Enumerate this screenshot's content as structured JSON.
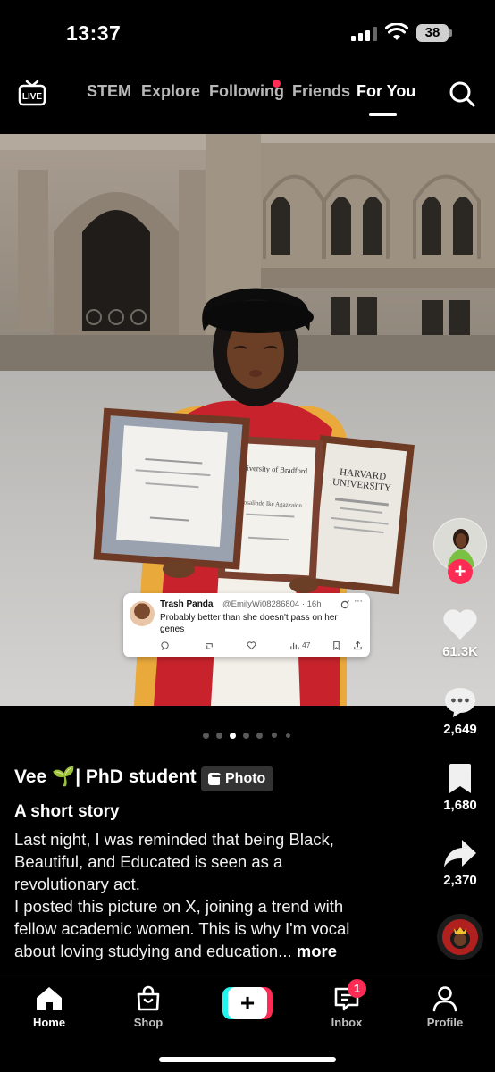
{
  "status_bar": {
    "time": "13:37",
    "battery": "38"
  },
  "top_nav": {
    "live_label": "LIVE",
    "tabs": [
      {
        "label": "STEM"
      },
      {
        "label": "Explore"
      },
      {
        "label": "Following"
      },
      {
        "label": "For You"
      }
    ],
    "active_tab": "For You",
    "following_has_dot": true
  },
  "post": {
    "media_type": "photo carousel",
    "carousel": {
      "total": 7,
      "active_index": 2
    },
    "tweet": {
      "name": "Trash Panda",
      "handle": "@EmilyWi08286804 · 16h",
      "text": "Probably better than she doesn't pass on her genes",
      "views": "47"
    },
    "diploma_texts": {
      "university": "University of Bradford",
      "harvard_1": "HARVARD",
      "harvard_2": "UNIVERSITY",
      "recipient": "Rosalinde Ike Agazzaion"
    },
    "author": "Vee 🌱| PhD student",
    "badge": "Photo",
    "title": "A short story",
    "description_lines": [
      "Last night, I was reminded that being Black,",
      "Beautiful, and Educated is seen as a",
      "revolutionary act.",
      "I posted this picture on X, joining a trend with",
      "fellow academic women. This is why I'm vocal",
      "about loving studying and education..."
    ],
    "more_label": "more"
  },
  "actions": {
    "likes": "61.3K",
    "comments": "2,649",
    "saves": "1,680",
    "shares": "2,370"
  },
  "bottom_nav": {
    "items": [
      {
        "label": "Home"
      },
      {
        "label": "Shop"
      },
      {
        "label": "Inbox"
      },
      {
        "label": "Profile"
      }
    ],
    "inbox_badge": "1",
    "create_symbol": "+"
  },
  "colors": {
    "accent_red": "#fe2c55",
    "accent_cyan": "#25f4ee",
    "background": "#000000"
  },
  "icons": [
    "live-icon",
    "search-icon",
    "heart-icon",
    "comment-icon",
    "bookmark-icon",
    "share-icon",
    "home-icon",
    "shop-icon",
    "inbox-icon",
    "profile-icon"
  ]
}
